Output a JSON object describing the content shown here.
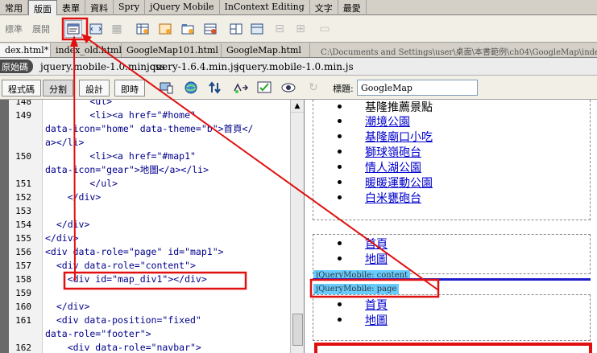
{
  "menu": {
    "tabs": [
      "常用",
      "版面",
      "表單",
      "資料",
      "Spry",
      "jQuery Mobile",
      "InContext Editing",
      "文字",
      "最愛"
    ],
    "active": 1
  },
  "toolbar": {
    "mode_standard": "標準",
    "mode_expand": "展開"
  },
  "doc_tabs": [
    "dex.html*",
    "index_old.html",
    "GoogleMap101.html",
    "GoogleMap.html"
  ],
  "doc_path": "C:\\Documents and Settings\\user\\桌面\\本書範例\\ch04\\GoogleMap\\index.html",
  "related": {
    "source_label": "原始碼",
    "files": [
      "jquery.mobile-1.0.min.css",
      "jquery-1.6.4.min.js",
      "jquery.mobile-1.0.min.js"
    ]
  },
  "viewbar": {
    "code": "程式碼",
    "split": "分割",
    "design": "設計",
    "live": "即時",
    "title_label": "標題:",
    "title_value": "GoogleMap"
  },
  "code_lines": [
    {
      "n": "148",
      "t": "        <ul>"
    },
    {
      "n": "149",
      "t": "        <li><a href=\"#home\""
    },
    {
      "n": "",
      "t": "data-icon=\"home\" data-theme=\"b\">首頁</"
    },
    {
      "n": "",
      "t": "a></li>"
    },
    {
      "n": "150",
      "t": "        <li><a href=\"#map1\""
    },
    {
      "n": "",
      "t": "data-icon=\"gear\">地圖</a></li>"
    },
    {
      "n": "151",
      "t": "        </ul>"
    },
    {
      "n": "152",
      "t": "    </div>"
    },
    {
      "n": "153",
      "t": ""
    },
    {
      "n": "154",
      "t": "  </div>"
    },
    {
      "n": "155",
      "t": "</div>"
    },
    {
      "n": "156",
      "t": "<div data-role=\"page\" id=\"map1\">"
    },
    {
      "n": "157",
      "t": "  <div data-role=\"content\">"
    },
    {
      "n": "158",
      "t": "    <div id=\"map_div1\"></div>"
    },
    {
      "n": "159",
      "t": ""
    },
    {
      "n": "160",
      "t": "  </div>"
    },
    {
      "n": "161",
      "t": "  <div data-position=\"fixed\""
    },
    {
      "n": "",
      "t": "data-role=\"footer\">"
    },
    {
      "n": "162",
      "t": "    <div data-role=\"navbar\">"
    }
  ],
  "design": {
    "list1": [
      "基隆推薦景點",
      "潮境公園",
      "基隆廟口小吃",
      "獅球嶺砲台",
      "情人湖公園",
      "暖暖運動公園",
      "白米甕砲台"
    ],
    "list2": [
      "首頁",
      "地圖"
    ],
    "label_content": "jQueryMobile: content",
    "label_page": "jQueryMobile: page",
    "list3": [
      "首頁",
      "地圖"
    ]
  },
  "colors": {
    "annotation": "#e01010",
    "link": "#0000cc",
    "label_bg": "#66ccff"
  }
}
